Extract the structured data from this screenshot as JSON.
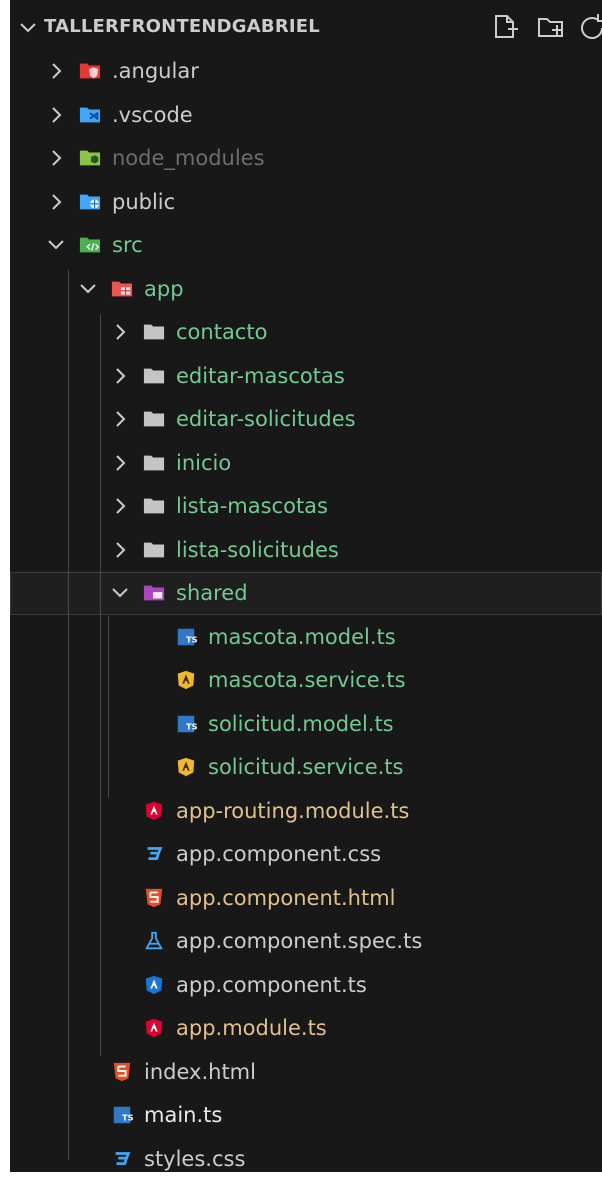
{
  "explorer": {
    "title": "TALLERFRONTENDGABRIEL",
    "header_actions": [
      "new-file-icon",
      "new-folder-icon",
      "refresh-icon"
    ],
    "items": [
      {
        "name": ".angular",
        "type": "folder",
        "expanded": false,
        "depth": 0,
        "icon": "angular-folder-icon",
        "status": "normal"
      },
      {
        "name": ".vscode",
        "type": "folder",
        "expanded": false,
        "depth": 0,
        "icon": "vscode-folder-icon",
        "status": "normal"
      },
      {
        "name": "node_modules",
        "type": "folder",
        "expanded": false,
        "depth": 0,
        "icon": "node-folder-icon",
        "status": "ignored"
      },
      {
        "name": "public",
        "type": "folder",
        "expanded": false,
        "depth": 0,
        "icon": "public-folder-icon",
        "status": "normal"
      },
      {
        "name": "src",
        "type": "folder",
        "expanded": true,
        "depth": 0,
        "icon": "src-folder-icon",
        "status": "untracked"
      },
      {
        "name": "app",
        "type": "folder",
        "expanded": true,
        "depth": 1,
        "icon": "app-folder-icon",
        "status": "untracked"
      },
      {
        "name": "contacto",
        "type": "folder",
        "expanded": false,
        "depth": 2,
        "icon": "folder-icon",
        "status": "untracked"
      },
      {
        "name": "editar-mascotas",
        "type": "folder",
        "expanded": false,
        "depth": 2,
        "icon": "folder-icon",
        "status": "untracked"
      },
      {
        "name": "editar-solicitudes",
        "type": "folder",
        "expanded": false,
        "depth": 2,
        "icon": "folder-icon",
        "status": "untracked"
      },
      {
        "name": "inicio",
        "type": "folder",
        "expanded": false,
        "depth": 2,
        "icon": "folder-icon",
        "status": "untracked"
      },
      {
        "name": "lista-mascotas",
        "type": "folder",
        "expanded": false,
        "depth": 2,
        "icon": "folder-icon",
        "status": "untracked"
      },
      {
        "name": "lista-solicitudes",
        "type": "folder",
        "expanded": false,
        "depth": 2,
        "icon": "folder-icon",
        "status": "untracked"
      },
      {
        "name": "shared",
        "type": "folder",
        "expanded": true,
        "depth": 2,
        "icon": "shared-folder-icon",
        "status": "untracked",
        "selected": true
      },
      {
        "name": "mascota.model.ts",
        "type": "file",
        "depth": 3,
        "icon": "typescript-icon",
        "status": "untracked"
      },
      {
        "name": "mascota.service.ts",
        "type": "file",
        "depth": 3,
        "icon": "angular-service-icon",
        "status": "untracked"
      },
      {
        "name": "solicitud.model.ts",
        "type": "file",
        "depth": 3,
        "icon": "typescript-icon",
        "status": "untracked"
      },
      {
        "name": "solicitud.service.ts",
        "type": "file",
        "depth": 3,
        "icon": "angular-service-icon",
        "status": "untracked"
      },
      {
        "name": "app-routing.module.ts",
        "type": "file",
        "depth": 2,
        "icon": "angular-module-icon",
        "status": "modified"
      },
      {
        "name": "app.component.css",
        "type": "file",
        "depth": 2,
        "icon": "css-icon",
        "status": "normal"
      },
      {
        "name": "app.component.html",
        "type": "file",
        "depth": 2,
        "icon": "html-icon",
        "status": "modified"
      },
      {
        "name": "app.component.spec.ts",
        "type": "file",
        "depth": 2,
        "icon": "test-flask-icon",
        "status": "normal"
      },
      {
        "name": "app.component.ts",
        "type": "file",
        "depth": 2,
        "icon": "angular-component-icon",
        "status": "normal"
      },
      {
        "name": "app.module.ts",
        "type": "file",
        "depth": 2,
        "icon": "angular-module-icon",
        "status": "modified"
      },
      {
        "name": "index.html",
        "type": "file",
        "depth": 1,
        "icon": "html-icon",
        "status": "normal"
      },
      {
        "name": "main.ts",
        "type": "file",
        "depth": 1,
        "icon": "typescript-icon",
        "status": "bright"
      },
      {
        "name": "styles.css",
        "type": "file",
        "depth": 1,
        "icon": "css-icon",
        "status": "normal"
      }
    ]
  },
  "colors": {
    "background": "#181818",
    "untracked": "#73c991",
    "modified": "#e2c08d",
    "ignored": "#6d6d6d",
    "normal": "#cccccc",
    "typescript": "#3178c6",
    "angular_red": "#dd0031",
    "angular_yellow": "#f0b72f",
    "html": "#e44d26",
    "css": "#42a5f5"
  }
}
